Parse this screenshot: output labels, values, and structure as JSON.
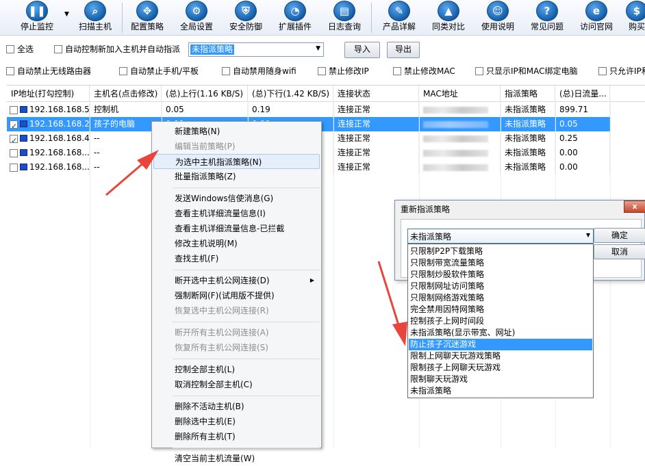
{
  "toolbar": {
    "items": [
      {
        "label": "停止监控",
        "icon": "pause-icon",
        "glyph": "❚❚"
      },
      {
        "label": "扫描主机",
        "icon": "magnifier-icon",
        "glyph": "⌕"
      },
      {
        "label": "配置策略",
        "icon": "network-icon",
        "glyph": "✥"
      },
      {
        "label": "全局设置",
        "icon": "gear-icon",
        "glyph": "⚙"
      },
      {
        "label": "安全防御",
        "icon": "shield-icon",
        "glyph": "⛨"
      },
      {
        "label": "扩展插件",
        "icon": "pie-icon",
        "glyph": "◔"
      },
      {
        "label": "日志查询",
        "icon": "document-icon",
        "glyph": "▤"
      },
      {
        "label": "产品详解",
        "icon": "product-icon",
        "glyph": "✎"
      },
      {
        "label": "同类对比",
        "icon": "compare-icon",
        "glyph": "▲"
      },
      {
        "label": "使用说明",
        "icon": "help-person-icon",
        "glyph": "☺"
      },
      {
        "label": "常见问题",
        "icon": "question-icon",
        "glyph": "?"
      },
      {
        "label": "访问官网",
        "icon": "browser-icon",
        "glyph": "e"
      },
      {
        "label": "购买",
        "icon": "cart-icon",
        "glyph": "$"
      }
    ]
  },
  "options": {
    "select_all": "全选",
    "auto_control": "自动控制新加入主机并自动指派",
    "policy_select_value": "未指派策略",
    "import": "导入",
    "export": "导出",
    "auto_block_router": "自动禁止无线路由器",
    "auto_block_phone": "自动禁止手机/平板",
    "auto_block_wifi": "自动禁用随身wifi",
    "block_ip_change": "禁止修改IP",
    "block_mac_change": "禁止修改MAC",
    "show_bound_only": "只显示IP和MAC绑定电脑",
    "allow_ip": "只允许IP和"
  },
  "table": {
    "headers": [
      "IP地址(打勾控制)",
      "主机名(点击修改)",
      "(总)上行(1.16 KB/S)",
      "(总)下行(1.42 KB/S)",
      "连接状态",
      "MAC地址",
      "指派策略",
      "(总)日流量..."
    ],
    "rows": [
      {
        "checked": false,
        "ip": "192.168.168.5",
        "name": "控制机",
        "up": "0.05",
        "down": "0.19",
        "status": "连接正常",
        "policy": "未指派策略",
        "daily": "899.71",
        "selected": false
      },
      {
        "checked": true,
        "ip": "192.168.168.2",
        "name": "孩子的电脑",
        "up": "0.00",
        "down": "0.00",
        "status": "连接正常",
        "policy": "未指派策略",
        "daily": "0.05",
        "selected": true
      },
      {
        "checked": true,
        "ip": "192.168.168.4",
        "name": "--",
        "up": "",
        "down": "",
        "status": "连接正常",
        "policy": "未指派策略",
        "daily": "0.25",
        "selected": false
      },
      {
        "checked": false,
        "ip": "192.168.168...",
        "name": "--",
        "up": "",
        "down": "",
        "status": "连接正常",
        "policy": "未指派策略",
        "daily": "0.00",
        "selected": false
      },
      {
        "checked": false,
        "ip": "192.168.168...",
        "name": "--",
        "up": "",
        "down": "",
        "status": "连接正常",
        "policy": "未指派策略",
        "daily": "0.00",
        "selected": false
      }
    ]
  },
  "context_menu": {
    "items": [
      {
        "label": "新建策略(N)",
        "disabled": false
      },
      {
        "label": "编辑当前策略(P)",
        "disabled": true
      },
      {
        "label": "为选中主机指派策略(N)",
        "disabled": false,
        "highlight": true
      },
      {
        "label": "批量指派策略(Z)",
        "disabled": false
      },
      {
        "sep": true
      },
      {
        "label": "发送Windows信使消息(G)",
        "disabled": false
      },
      {
        "label": "查看主机详细流量信息(I)",
        "disabled": false
      },
      {
        "label": "查看主机详细流量信息-已拦截",
        "disabled": false
      },
      {
        "label": "修改主机说明(M)",
        "disabled": false
      },
      {
        "label": "查找主机(F)",
        "disabled": false
      },
      {
        "sep": true
      },
      {
        "label": "断开选中主机公网连接(D)",
        "disabled": false,
        "submenu": true
      },
      {
        "label": "强制断网(F)(试用版不提供)",
        "disabled": false
      },
      {
        "label": "恢复选中主机公网连接(R)",
        "disabled": true
      },
      {
        "sep": true
      },
      {
        "label": "断开所有主机公网连接(A)",
        "disabled": true
      },
      {
        "label": "恢复所有主机公网连接(S)",
        "disabled": true
      },
      {
        "sep": true
      },
      {
        "label": "控制全部主机(L)",
        "disabled": false
      },
      {
        "label": "取消控制全部主机(C)",
        "disabled": false
      },
      {
        "sep": true
      },
      {
        "label": "删除不活动主机(B)",
        "disabled": false
      },
      {
        "label": "删除选中主机(E)",
        "disabled": false
      },
      {
        "label": "删除所有主机(T)",
        "disabled": false
      },
      {
        "sep": true
      },
      {
        "label": "清空当前主机流量(W)",
        "disabled": false
      }
    ]
  },
  "dialog": {
    "title": "重新指派策略",
    "close": "x",
    "selected": "未指派策略",
    "ok": "确定",
    "cancel": "取消",
    "options": [
      "只限制P2P下载策略",
      "只限制带宽流量策略",
      "只限制炒股软件策略",
      "只限制网址访问策略",
      "只限制网络游戏策略",
      "完全禁用因特网策略",
      "控制孩子上网时间段",
      "未指派策略(显示带宽、网址)",
      "防止孩子沉迷游戏",
      "限制上网聊天玩游戏策略",
      "限制孩子上网聊天玩游戏",
      "限制聊天玩游戏",
      "未指派策略"
    ],
    "highlighted_index": 8
  },
  "colors": {
    "selection": "#3399ff",
    "annotation_arrow": "#e8453c"
  }
}
